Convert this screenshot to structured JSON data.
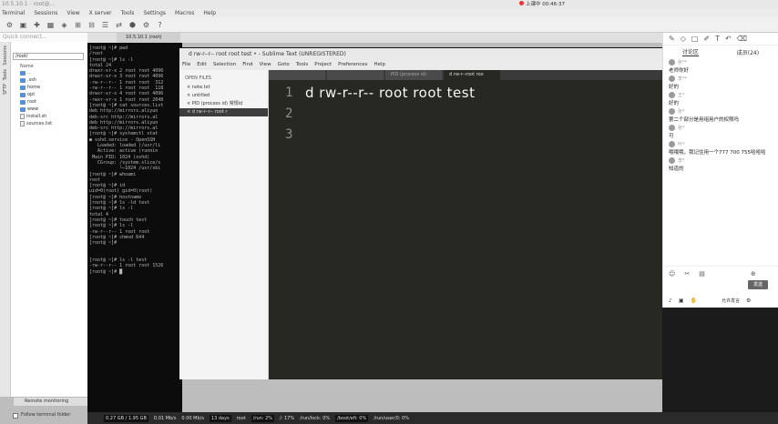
{
  "window": {
    "title": "10.5.10.1 - root@..."
  },
  "recording": {
    "label": "上课中 00:46:37"
  },
  "menubar": [
    "Terminal",
    "Sessions",
    "View",
    "X server",
    "Tools",
    "Settings",
    "Macros",
    "Help"
  ],
  "quick_connect": {
    "placeholder": "Quick connect..."
  },
  "left_tabs": [
    "Sessions",
    "Tools",
    "SFTP"
  ],
  "sidebar": {
    "path": "/root/",
    "column_header": "Name",
    "items": [
      "..",
      " .ssh",
      "home",
      "opt",
      "root",
      "www",
      "install.sh",
      "sources.list"
    ]
  },
  "session_tab": {
    "label": "10.5.10.1 (root)"
  },
  "terminal": {
    "lines": [
      "[root@ ~]# pwd",
      "/root",
      "[root@ ~]# ls -l",
      "total 24",
      "drwxr-xr-x 2 root root 4096",
      "drwxr-xr-x 3 root root 4096",
      "-rw-r--r-- 1 root root  312",
      "-rw-r--r-- 1 root root  118",
      "drwxr-xr-x 4 root root 4096",
      "-rwxr-xr-x 1 root root 2048",
      "[root@ ~]# cat sources.list",
      "deb http://mirrors.aliyun",
      "deb-src http://mirrors.al",
      "deb http://mirrors.aliyun",
      "deb-src http://mirrors.al",
      "[root@ ~]# systemctl stat",
      "● sshd.service - OpenSSH",
      "   Loaded: loaded (/usr/li",
      "   Active: active (runnin",
      " Main PID: 1024 (sshd)",
      "   CGroup: /system.slice/s",
      "           └─1024 /usr/sbi",
      "[root@ ~]# whoami",
      "root",
      "[root@ ~]# id",
      "uid=0(root) gid=0(root)",
      "[root@ ~]# hostname",
      "[root@ ~]# ls -ld test",
      "[root@ ~]# ls -l",
      "total 4",
      "[root@ ~]# touch test",
      "[root@ ~]# ls -l",
      "-rw-r--r-- 1 root root ",
      "[root@ ~]# chmod 644",
      "[root@ ~]#",
      "",
      "",
      "[root@ ~]# ls -l test",
      "-rw-r--r-- 1 root root 1526",
      "[root@ ~]# █"
    ]
  },
  "remote_monitoring": "Remote monitoring",
  "follow_folder": "Follow terminal folder",
  "statusbar": [
    "0.27 GB / 1.95 GB",
    "0.01 Mb/s",
    "0.00 Mb/s",
    "13 days",
    "root",
    "/run: 2%",
    "/: 17%",
    "/run/lock: 0%",
    "/boot/efi: 0%",
    "/run/user/0: 0%"
  ],
  "sublime": {
    "title": "d rw-r--r-- root root test • - Sublime Text (UNREGISTERED)",
    "menu": [
      "File",
      "Edit",
      "Selection",
      "Find",
      "View",
      "Goto",
      "Tools",
      "Project",
      "Preferences",
      "Help"
    ],
    "open_files_label": "OPEN FILES",
    "open_files": [
      "note.txt",
      "untitled",
      "PID (process id) 常规id",
      "d rw-r--r-- root r"
    ],
    "tabs": [
      "",
      "",
      "PID (process id)",
      "d rw-r--root roo"
    ],
    "line_numbers": [
      "1",
      "2",
      "3"
    ],
    "lines": [
      "d rw-r--r-- root root test",
      "",
      ""
    ]
  },
  "chat": {
    "tabs": [
      "讨论区",
      "成员(24)"
    ],
    "messages": [
      {
        "who": "张**",
        "text": "老师你好"
      },
      {
        "who": "李**",
        "text": "好的"
      },
      {
        "who": "王*",
        "text": "好的"
      },
      {
        "who": "张*",
        "text": "第二个部分是用组用户的权限吗"
      },
      {
        "who": "张*",
        "text": "可"
      },
      {
        "who": "叶*",
        "text": "哦哦哦，我记住用一个777 700 755哈哈哈"
      },
      {
        "who": "李*",
        "text": "知道的"
      }
    ],
    "send_label": "发送",
    "bottom_right": "允许发言"
  }
}
